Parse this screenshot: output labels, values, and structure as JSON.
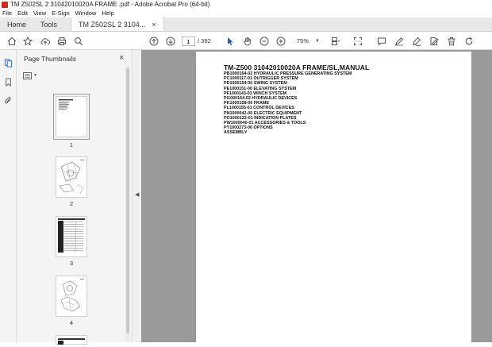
{
  "window": {
    "title": "TM Z502SL 2 31042010020A FRAME .pdf - Adobe Acrobat Pro (64-bit)"
  },
  "menu": [
    "File",
    "Edit",
    "View",
    "E-Sign",
    "Window",
    "Help"
  ],
  "tabs": {
    "home": "Home",
    "tools": "Tools",
    "document": "TM Z502SL 2 3104...",
    "close": "×"
  },
  "toolbar": {
    "current_page": "1",
    "total_pages": "/ 392",
    "zoom": "75%"
  },
  "thumbnail_panel": {
    "title": "Page Thumbnails",
    "close": "×",
    "pages": [
      {
        "number": "1"
      },
      {
        "number": "2"
      },
      {
        "number": "3"
      },
      {
        "number": "4"
      }
    ]
  },
  "document": {
    "heading": "TM-Z500 31042010020A FRAME/SL,MANUAL",
    "lines": [
      "PB1000164-02 HYDRAULIC PRESSURE GENERATING SYSTEM",
      "PC1000117-01 OUTRIGGER SYSTEM",
      "PD1000154-00 SWING SYSTEM",
      "PE1000151-00 ELEVATING SYSTEM",
      "PF1000143-03 WINCH SYSTEM",
      "PI1000164-02 HYDRAULIC DEVICES",
      "PK1000158-00 FRAME",
      "PL1000155-01 CONTROL DEVICES",
      "PN1000042-00 ELECTRIC EQUIPMENT",
      "PO1000122-01 INDICATION PLATES",
      "PW1000040-01 ACCESSORIES & TOOLS",
      "PY1000273-00 OPTIONS",
      "ASSEMBLY"
    ]
  }
}
